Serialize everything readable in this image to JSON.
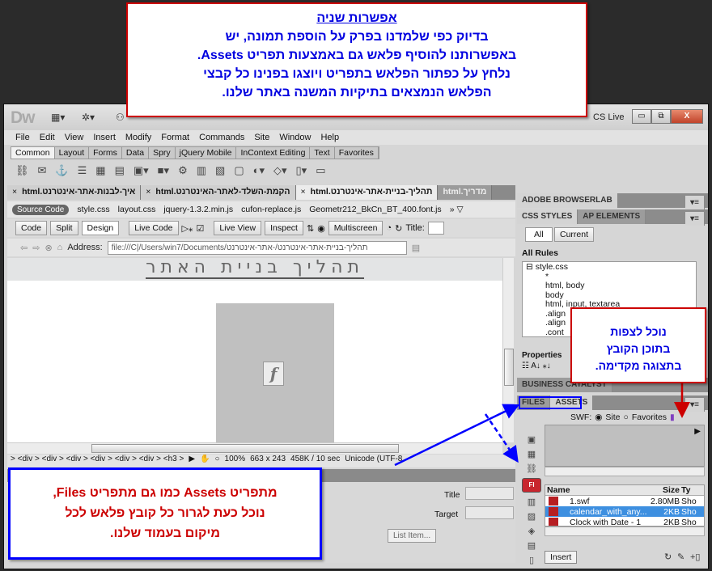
{
  "app": {
    "logo": "Dw",
    "cs_live": "CS Live",
    "window_controls": {
      "minimize": "▭",
      "restore": "⧉",
      "close": "X"
    }
  },
  "menu": [
    "File",
    "Edit",
    "View",
    "Insert",
    "Modify",
    "Format",
    "Commands",
    "Site",
    "Window",
    "Help"
  ],
  "insert_tabs": [
    {
      "label": "Common",
      "active": true
    },
    {
      "label": "Layout"
    },
    {
      "label": "Forms"
    },
    {
      "label": "Data"
    },
    {
      "label": "Spry"
    },
    {
      "label": "jQuery Mobile"
    },
    {
      "label": "InContext Editing"
    },
    {
      "label": "Text"
    },
    {
      "label": "Favorites"
    }
  ],
  "insert_icons": [
    "hyperlink-icon",
    "email-link-icon",
    "named-anchor-icon",
    "horizontal-rule-icon",
    "table-icon",
    "insert-div-icon",
    "images-icon",
    "media-flash-icon",
    "widget-icon",
    "date-icon",
    "server-side-include-icon",
    "comment-icon",
    "head-icon",
    "script-icon",
    "templates-icon",
    "tag-chooser-icon"
  ],
  "doc_tabs": [
    {
      "label": "איך-לבנות-אתר-אינטרנט.html",
      "close": "×"
    },
    {
      "label": "הקמת-השלד-לאתר-האינטרנט.html",
      "close": "×"
    },
    {
      "label": "תהליך-בניית-אתר-אינטרנט.html",
      "close": "×",
      "active": true
    },
    {
      "label": "מדריך.html",
      "dim": true
    }
  ],
  "related_files": {
    "source": "Source Code",
    "files": [
      "style.css",
      "layout.css",
      "jquery-1.3.2.min.js",
      "cufon-replace.js",
      "Geometr212_BkCn_BT_400.font.js"
    ]
  },
  "view_toolbar": {
    "code": "Code",
    "split": "Split",
    "design": "Design",
    "live_code": "Live Code",
    "live_view": "Live View",
    "inspect": "Inspect",
    "multiscreen": "Multiscreen",
    "title_label": "Title:"
  },
  "address_bar": {
    "label": "Address:",
    "value": "file:///C|/Users/win7/Documents/תהליך-בניית-אתר-אינטרנט/-אתר-אינטרנט"
  },
  "design_view": {
    "heading": "תהליך בניית האתר",
    "flash_placeholder": "f"
  },
  "status_bar": {
    "tags": "> <div > <div > <div > <div > <div > <div > <h3 >",
    "zoom": "100%",
    "dimensions": "663 x 243",
    "size_time": "458K / 10 sec",
    "encoding": "Unicode (UTF-8"
  },
  "properties_panel": {
    "title_label": "Title",
    "target_label": "Target",
    "list_item_button": "List Item..."
  },
  "right_panel": {
    "browserlab": "ADOBE BROWSERLAB",
    "css_tabs": [
      "CSS STYLES",
      "AP ELEMENTS"
    ],
    "all_btn": "All",
    "current_btn": "Current",
    "all_rules": "All Rules",
    "stylesheet": "style.css",
    "rules": [
      "*",
      "html, body",
      "body",
      "html, input, textarea",
      ".align",
      ".align",
      ".cont"
    ],
    "properties_label": "Properties",
    "business_catalyst": "BUSINESS CATALYST",
    "files_tab": "FILES",
    "assets_tab": "ASSETS",
    "swf_label": "SWF:",
    "site_radio": "Site",
    "favorites_radio": "Favorites",
    "site_selected": true,
    "columns": [
      "Name",
      "Size",
      "Ty"
    ],
    "files": [
      {
        "name": "1.swf",
        "size": "2.80MB",
        "type": "Sho"
      },
      {
        "name": "calendar_with_any...",
        "size": "2KB",
        "type": "Sho",
        "selected": true
      },
      {
        "name": "Clock with Date - 1",
        "size": "2KB",
        "type": "Sho"
      }
    ],
    "insert_btn": "Insert"
  },
  "callouts": {
    "top": {
      "title": "אפשרות שניה",
      "lines": [
        "בדיוק כפי שלמדנו בפרק על הוספת תמונה, יש",
        "באפשרותנו להוסיף פלאש גם באמצעות תפריט Assets.",
        "נלחץ על כפתור הפלאש בתפריט ויוצגו בפנינו כל קבצי",
        "הפלאש הנמצאים בתיקיות המשנה באתר שלנו."
      ]
    },
    "right": {
      "lines": [
        "נוכל לצפות",
        "בתוכן הקובץ",
        "בתצוגה מקדימה."
      ]
    },
    "bottom": {
      "lines": [
        "מתפריט Assets כמו גם מתפריט Files,",
        "נוכל כעת לגרור כל קובץ פלאש לכל",
        "מיקום בעמוד שלנו."
      ]
    }
  },
  "colors": {
    "callout_border_red": "#cc0000",
    "callout_text_blue": "#0000e0",
    "callout_border_blue": "#0000ff",
    "callout_text_red": "#cc0000",
    "selection_blue": "#3d8fe0"
  }
}
